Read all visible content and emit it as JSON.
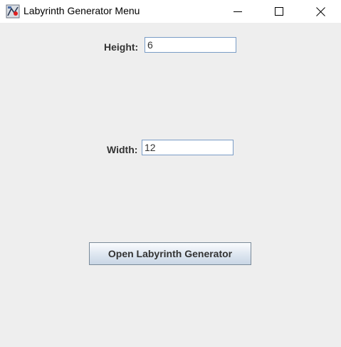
{
  "window": {
    "title": "Labyrinth Generator Menu",
    "controls": [
      "minimize-icon",
      "maximize-icon",
      "close-icon"
    ]
  },
  "form": {
    "height_label": "Height:",
    "height_value": "6",
    "width_label": "Width:",
    "width_value": "12"
  },
  "actions": {
    "open_button_label": "Open Labyrinth Generator"
  },
  "colors": {
    "background": "#eeeeee",
    "titlebar": "#ffffff",
    "input_border": "#7a9cc6",
    "label_text": "#333333"
  }
}
